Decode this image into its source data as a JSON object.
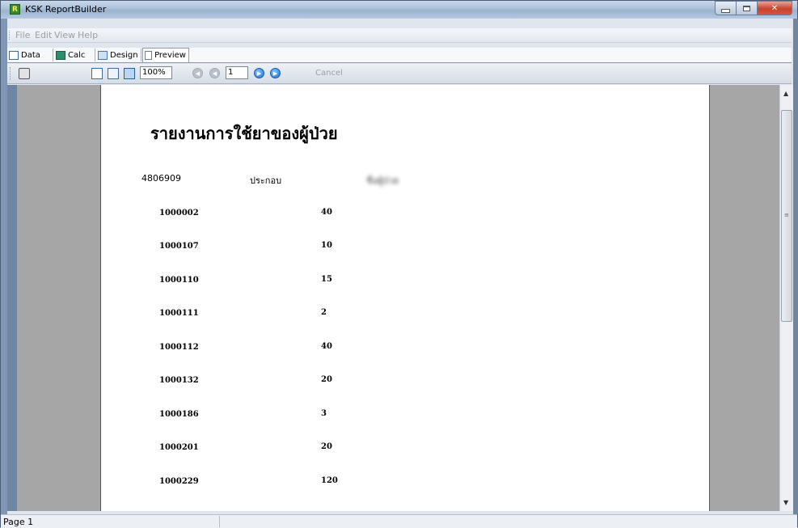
{
  "window": {
    "title": "KSK ReportBuilder",
    "icon_letter": "R"
  },
  "menu": {
    "items": [
      "File",
      "Edit",
      "View",
      "Help"
    ]
  },
  "tabs": [
    {
      "label": "Data",
      "icon": "data-icon"
    },
    {
      "label": "Calc",
      "icon": "calc-icon"
    },
    {
      "label": "Design",
      "icon": "design-icon"
    },
    {
      "label": "Preview",
      "icon": "preview-icon",
      "active": true
    }
  ],
  "toolbar": {
    "zoom": "100%",
    "page": "1",
    "cancel_label": "Cancel"
  },
  "report": {
    "title": "รายงานการใช้ยาของผู้ป่วย",
    "header": {
      "hn": "4806909",
      "label": "ประกอบ",
      "blurred_name": "ชื่อผู้ป่วย"
    },
    "rows": [
      {
        "code": "1000002",
        "qty": "40"
      },
      {
        "code": "1000107",
        "qty": "10"
      },
      {
        "code": "1000110",
        "qty": "15"
      },
      {
        "code": "1000111",
        "qty": "2"
      },
      {
        "code": "1000112",
        "qty": "40"
      },
      {
        "code": "1000132",
        "qty": "20"
      },
      {
        "code": "1000186",
        "qty": "3"
      },
      {
        "code": "1000201",
        "qty": "20"
      },
      {
        "code": "1000229",
        "qty": "120"
      }
    ]
  },
  "status": {
    "text": "Page 1"
  }
}
